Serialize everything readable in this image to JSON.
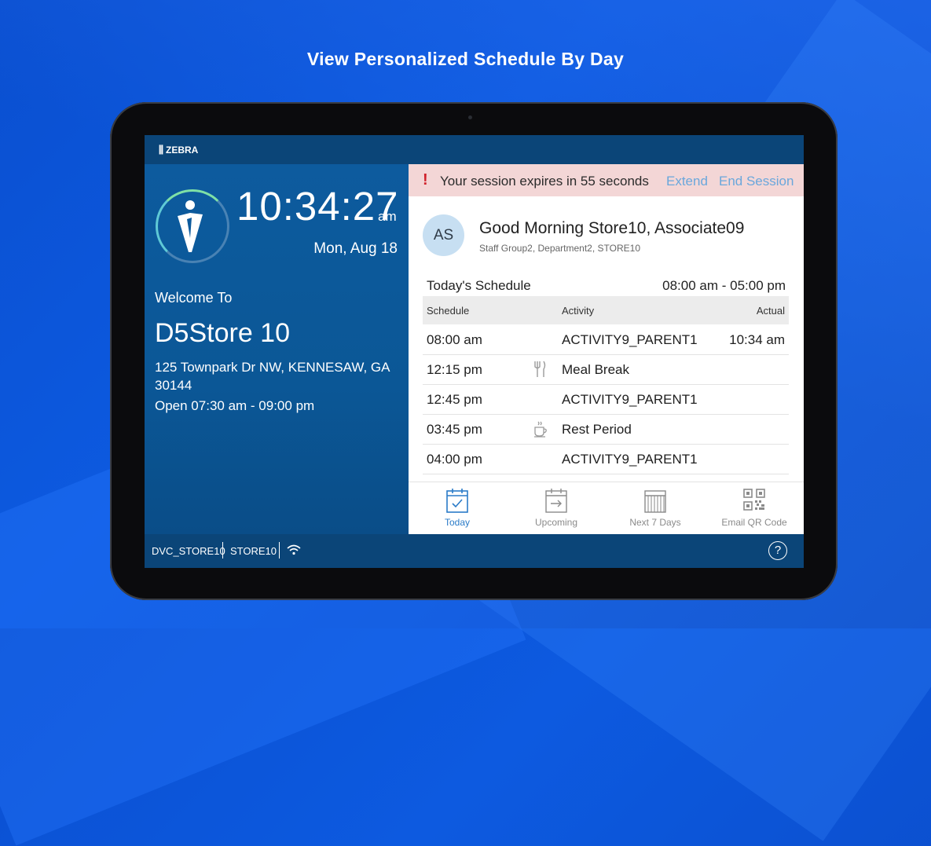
{
  "headline": "View Personalized Schedule By Day",
  "brand": "ZEBRA",
  "clock": {
    "time": "10:34:27",
    "ampm": "am",
    "date": "Mon, Aug 18"
  },
  "store": {
    "welcome": "Welcome To",
    "name": "D5Store 10",
    "address": "125 Townpark Dr NW, KENNESAW, GA 30144",
    "hours": "Open 07:30 am - 09:00 pm"
  },
  "session": {
    "message": "Your session expires in 55 seconds",
    "extend_label": "Extend",
    "end_label": "End Session",
    "warn_color": "#d0202a"
  },
  "user": {
    "initials": "AS",
    "greeting": "Good Morning Store10, Associate09",
    "groups": "Staff Group2, Department2, STORE10"
  },
  "schedule": {
    "title": "Today's Schedule",
    "range": "08:00 am - 05:00 pm",
    "headers": {
      "schedule": "Schedule",
      "activity": "Activity",
      "actual": "Actual"
    },
    "rows": [
      {
        "time": "08:00 am",
        "icon": "",
        "activity": "ACTIVITY9_PARENT1",
        "actual": "10:34 am"
      },
      {
        "time": "12:15 pm",
        "icon": "utensils-icon",
        "activity": "Meal Break",
        "actual": ""
      },
      {
        "time": "12:45 pm",
        "icon": "",
        "activity": "ACTIVITY9_PARENT1",
        "actual": ""
      },
      {
        "time": "03:45 pm",
        "icon": "coffee-cup-icon",
        "activity": "Rest Period",
        "actual": ""
      },
      {
        "time": "04:00 pm",
        "icon": "",
        "activity": "ACTIVITY9_PARENT1",
        "actual": ""
      }
    ]
  },
  "tabs": [
    {
      "label": "Today",
      "icon": "calendar-check-icon",
      "active": true
    },
    {
      "label": "Upcoming",
      "icon": "calendar-arrow-icon",
      "active": false
    },
    {
      "label": "Next 7 Days",
      "icon": "calendar-week-icon",
      "active": false
    },
    {
      "label": "Email QR Code",
      "icon": "qr-code-icon",
      "active": false
    }
  ],
  "footer": {
    "device": "DVC_STORE10",
    "store": "STORE10",
    "help": "?"
  },
  "colors": {
    "accent": "#2a7bc8",
    "link": "#6aa7dc",
    "header": "#0b4578"
  }
}
